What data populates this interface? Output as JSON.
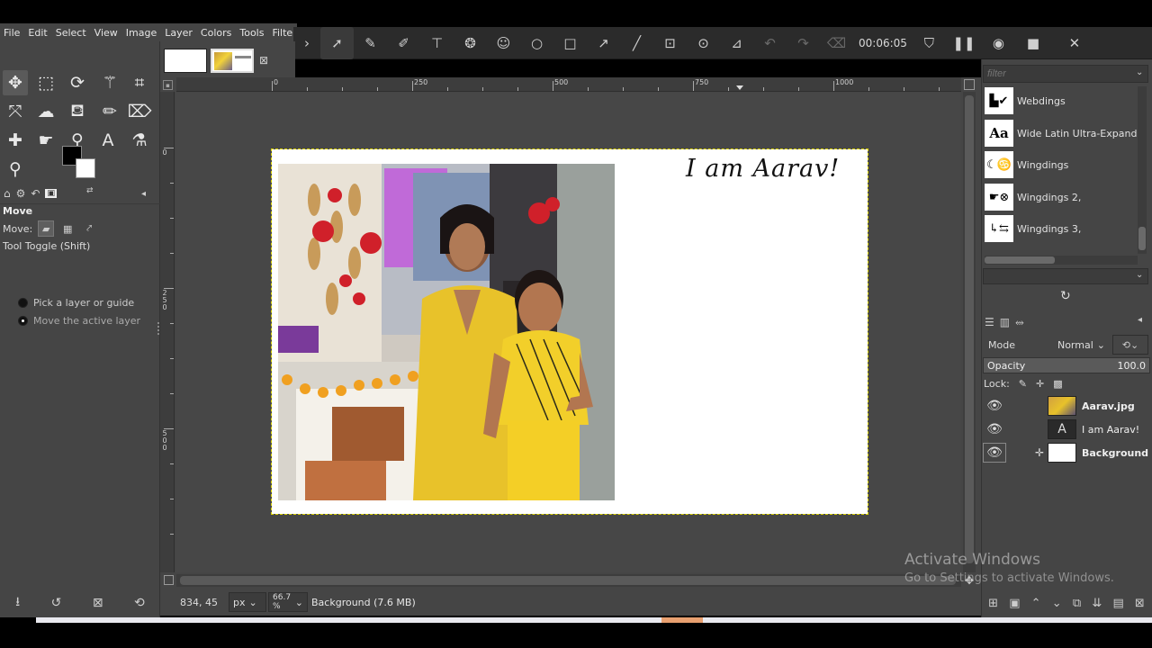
{
  "menu": {
    "items": [
      "File",
      "Edit",
      "Select",
      "View",
      "Image",
      "Layer",
      "Colors",
      "Tools",
      "Filters"
    ]
  },
  "recorder": {
    "time": "00:06:05",
    "icons": [
      "chevron-right-icon",
      "pointer-icon",
      "pen-icon",
      "highlighter-icon",
      "text-box-icon",
      "blur-icon",
      "emoji-icon",
      "circle-icon",
      "square-icon",
      "arrow-icon",
      "line-icon",
      "focus-icon",
      "zoom-icon",
      "edit-image-icon",
      "undo-icon",
      "redo-icon",
      "clear-icon"
    ]
  },
  "tool_options": {
    "title": "Move",
    "move_label": "Move:",
    "toggle_label": "Tool Toggle  (Shift)",
    "option_pick": "Pick a layer or guide",
    "option_move": "Move the active layer"
  },
  "ruler": {
    "top_labels": [
      "0",
      "250",
      "500",
      "750",
      "1000"
    ],
    "left_labels": [
      "0",
      "250",
      "500"
    ]
  },
  "document": {
    "title_text": "I am Aarav!"
  },
  "status": {
    "coords": "834, 45",
    "unit": "px",
    "zoom": "66.7 %",
    "message": "Background (7.6 MB)"
  },
  "fonts": {
    "filter_placeholder": "filter",
    "list": [
      {
        "name": "Webdings",
        "preview": "▙✔"
      },
      {
        "name": "Wide Latin Ultra-Expanded",
        "preview": "Aa"
      },
      {
        "name": "Wingdings",
        "preview": "☾♋"
      },
      {
        "name": "Wingdings 2,",
        "preview": "☛⊗"
      },
      {
        "name": "Wingdings 3,",
        "preview": "↳⇆"
      }
    ]
  },
  "layers": {
    "mode_label": "Mode",
    "mode_value": "Normal",
    "opacity_label": "Opacity",
    "opacity_value": "100.0",
    "lock_label": "Lock:",
    "items": [
      {
        "name": "Aarav.jpg"
      },
      {
        "name": "I am Aarav!"
      },
      {
        "name": "Background"
      }
    ]
  },
  "watermark": {
    "line1": "Activate Windows",
    "line2": "Go to Settings to activate Windows."
  }
}
